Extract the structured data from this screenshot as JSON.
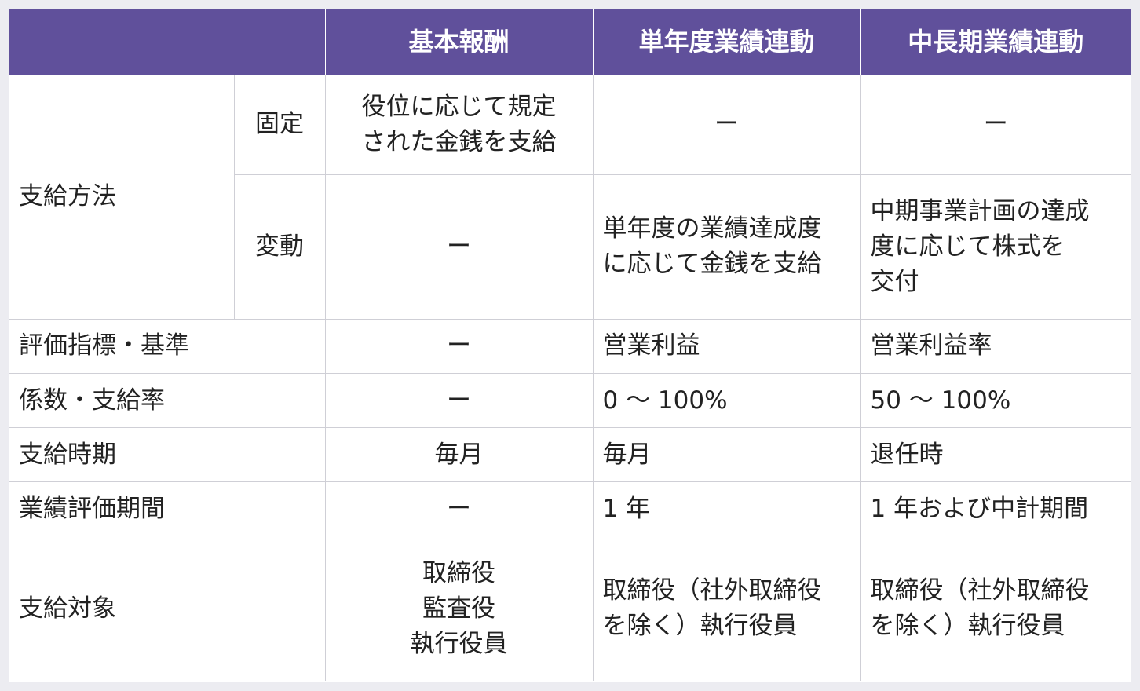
{
  "header": {
    "corner": "",
    "col_base": "基本報酬",
    "col_annual": "単年度業績連動",
    "col_longterm": "中長期業績連動"
  },
  "rows": {
    "payment_method": {
      "label": "支給方法",
      "fixed": {
        "label": "固定",
        "base": "役位に応じて規定\nされた金銭を支給",
        "annual": "ー",
        "longterm": "ー"
      },
      "variable": {
        "label": "変動",
        "base": "ー",
        "annual": "単年度の業績達成度\nに応じて金銭を支給",
        "longterm": "中期事業計画の達成\n度に応じて株式を\n交付"
      }
    },
    "evaluation_index": {
      "label": "評価指標・基準",
      "base": "ー",
      "annual": "営業利益",
      "longterm": "営業利益率"
    },
    "coefficient": {
      "label": "係数・支給率",
      "base": "ー",
      "annual": "0 ～ 100%",
      "longterm": "50 ～ 100%"
    },
    "payment_timing": {
      "label": "支給時期",
      "base": "毎月",
      "annual": "毎月",
      "longterm": "退任時"
    },
    "evaluation_period": {
      "label": "業績評価期間",
      "base": "ー",
      "annual": "1 年",
      "longterm": "1 年および中計期間"
    },
    "eligible": {
      "label": "支給対象",
      "base": "取締役\n監査役\n執行役員",
      "annual": "取締役（社外取締役\nを除く）執行役員",
      "longterm": "取締役（社外取締役\nを除く）執行役員"
    }
  },
  "colors": {
    "header_bg": "#60509b",
    "header_text": "#ffffff",
    "border": "#cfcfd6"
  }
}
